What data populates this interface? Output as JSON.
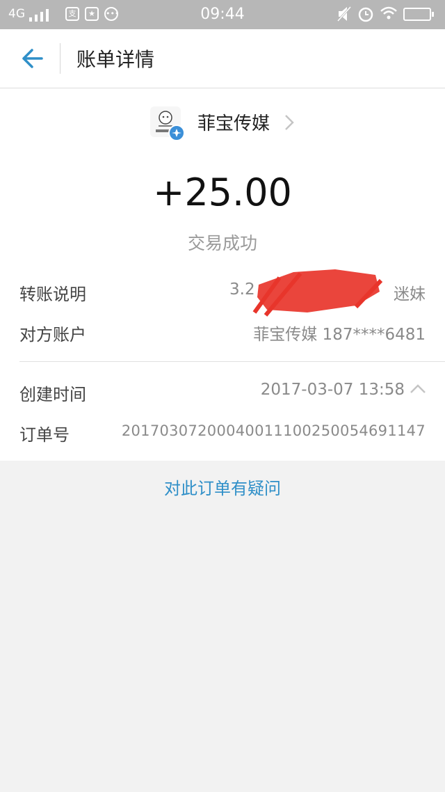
{
  "status_bar": {
    "network": "4G",
    "time": "09:44"
  },
  "header": {
    "title": "账单详情"
  },
  "payee": {
    "name": "菲宝传媒"
  },
  "transaction": {
    "amount": "+25.00",
    "status": "交易成功"
  },
  "details": {
    "memo_label": "转账说明",
    "memo_value_prefix": "3.2",
    "memo_value_suffix": "迷妹",
    "account_label": "对方账户",
    "account_value": "菲宝传媒 187****6481",
    "created_label": "创建时间",
    "created_value": "2017-03-07 13:58",
    "order_label": "订单号",
    "order_value": "20170307200040011100250054691147"
  },
  "footer": {
    "question_link": "对此订单有疑问"
  },
  "colors": {
    "accent": "#2f8fc8",
    "status_bar_bg": "#b7b7b7",
    "redaction": "#e8352b"
  }
}
